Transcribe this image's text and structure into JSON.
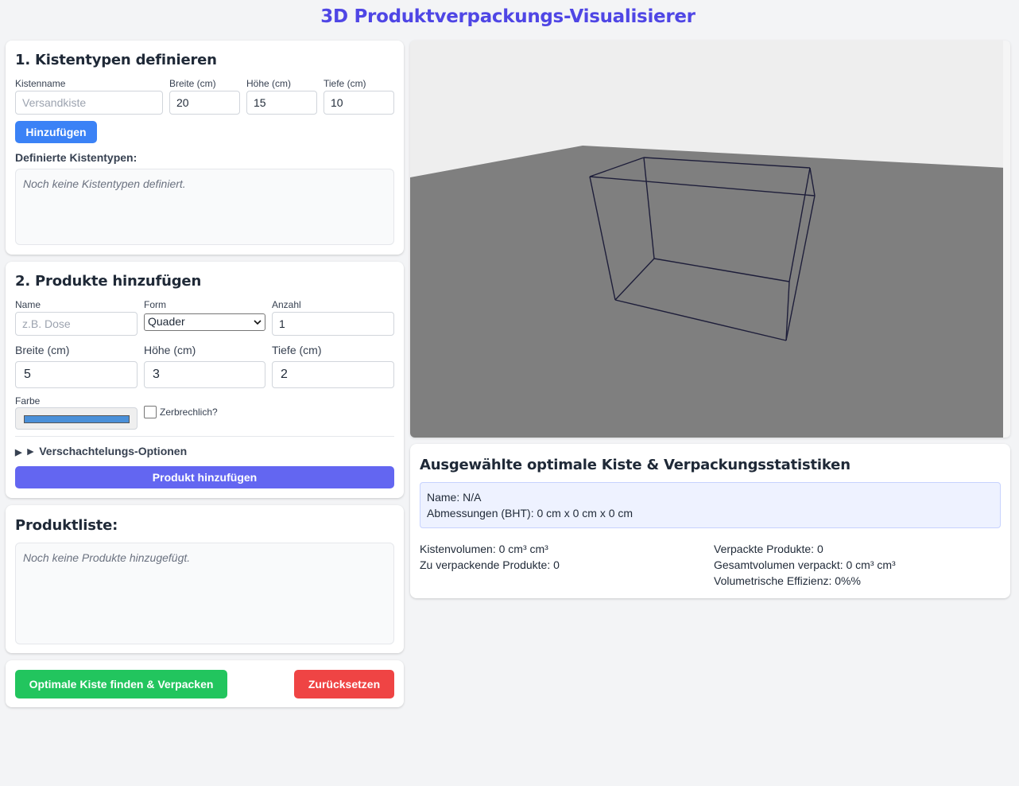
{
  "app": {
    "title": "3D Produktverpackungs-Visualisierer"
  },
  "section1": {
    "heading": "1. Kistentypen definieren",
    "name_label": "Kistenname",
    "name_placeholder": "Versandkiste",
    "width_label": "Breite (cm)",
    "width_value": "20",
    "height_label": "Höhe (cm)",
    "height_value": "15",
    "depth_label": "Tiefe (cm)",
    "depth_value": "10",
    "add_button": "Hinzufügen",
    "list_heading": "Definierte Kistentypen:",
    "empty_text": "Noch keine Kistentypen definiert."
  },
  "section2": {
    "heading": "2. Produkte hinzufügen",
    "name_label": "Name",
    "name_placeholder": "z.B. Dose",
    "shape_label": "Form",
    "shape_value": "Quader",
    "qty_label": "Anzahl",
    "qty_value": "1",
    "width_label": "Breite (cm)",
    "width_value": "5",
    "height_label": "Höhe (cm)",
    "height_value": "3",
    "depth_label": "Tiefe (cm)",
    "depth_value": "2",
    "color_label": "Farbe",
    "color_value": "#4a90d9",
    "fragile_label": "Zerbrechlich?",
    "nesting_label": "► Verschachtelungs-Optionen",
    "add_button": "Produkt hinzufügen"
  },
  "section3": {
    "heading": "Produktliste:",
    "empty_text": "Noch keine Produkte hinzugefügt."
  },
  "actions": {
    "find_button": "Optimale Kiste finden & Verpacken",
    "reset_button": "Zurücksetzen"
  },
  "stats": {
    "heading": "Ausgewählte optimale Kiste & Verpackungsstatistiken",
    "name_line": "Name: N/A",
    "dims_line": "Abmessungen (BHT): 0 cm x 0 cm x 0 cm",
    "box_volume": "Kistenvolumen: 0 cm³ cm³",
    "to_pack": "Zu verpackende Produkte: 0",
    "packed": "Verpackte Produkte: 0",
    "total_volume": "Gesamtvolumen verpackt: 0 cm³ cm³",
    "efficiency": "Volumetrische Effizienz: 0%%"
  },
  "colors": {
    "title": "#4f46e5",
    "add_box_button": "#3b82f6",
    "add_product_button": "#6366f1",
    "find_button": "#22c55e",
    "reset_button": "#ef4444"
  }
}
